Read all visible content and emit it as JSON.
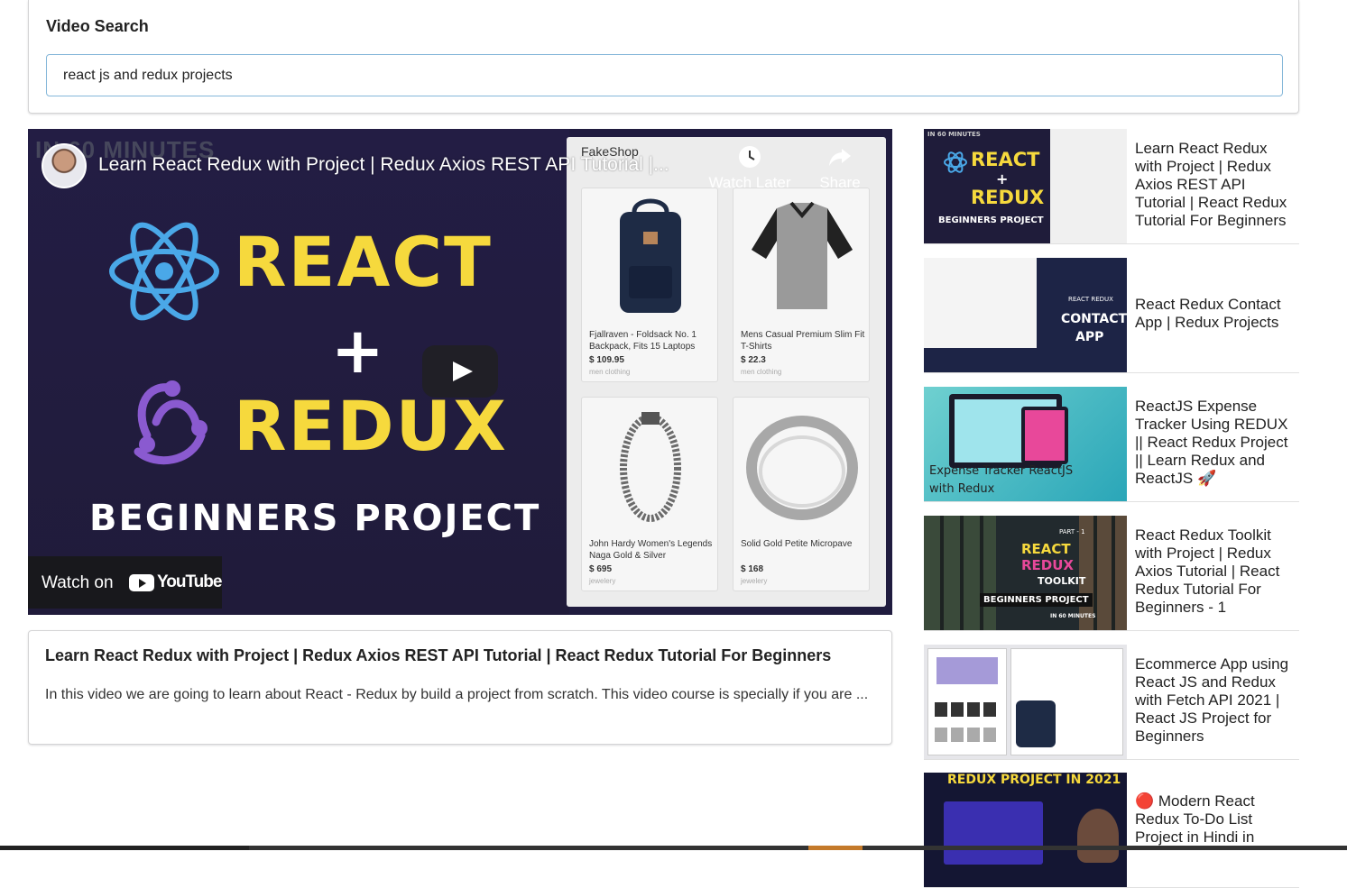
{
  "search": {
    "label": "Video Search",
    "value": "react js and redux projects"
  },
  "player": {
    "title": "Learn React Redux with Project | Redux Axios REST API Tutorial |...",
    "banner": "IN 60 MINUTES",
    "thumb_line1": "REACT",
    "thumb_plus": "+",
    "thumb_line2": "REDUX",
    "thumb_line3": "BEGINNERS PROJECT",
    "shop_name": "FakeShop",
    "products": [
      {
        "name": "Fjallraven - Foldsack No. 1 Backpack, Fits 15 Laptops",
        "price": "$ 109.95",
        "category": "men clothing"
      },
      {
        "name": "Mens Casual Premium Slim Fit T-Shirts",
        "price": "$ 22.3",
        "category": "men clothing"
      },
      {
        "name": "John Hardy Women's Legends Naga Gold & Silver",
        "price": "$ 695",
        "category": "jewelery"
      },
      {
        "name": "Solid Gold Petite Micropave",
        "price": "$ 168",
        "category": "jewelery"
      }
    ],
    "watch_later": "Watch Later",
    "share": "Share",
    "watch_on": "Watch on",
    "youtube": "YouTube"
  },
  "details": {
    "title": "Learn React Redux with Project | Redux Axios REST API Tutorial | React Redux Tutorial For Beginners",
    "description": "In this video we are going to learn about React - Redux by build a project from scratch. This video course is specially if you are ..."
  },
  "video_list": [
    {
      "title": "Learn React Redux with Project | Redux Axios REST API Tutorial | React Redux Tutorial For Beginners",
      "thumb_text": [
        "REACT",
        "+",
        "REDUX",
        "BEGINNERS PROJECT",
        "IN 60 MINUTES"
      ]
    },
    {
      "title": "React Redux Contact App | Redux Projects",
      "thumb_text": [
        "REACT REDUX",
        "CONTACT",
        "APP"
      ]
    },
    {
      "title": "ReactJS Expense Tracker Using REDUX || React Redux Project || Learn Redux and ReactJS 🚀",
      "thumb_text": [
        "Expense Tracker ReactJS",
        "with Redux"
      ]
    },
    {
      "title": "React Redux Toolkit with Project | Redux Axios Tutorial | React Redux Tutorial For Beginners - 1",
      "thumb_text": [
        "PART - 1",
        "REACT",
        "REDUX",
        "TOOLKIT",
        "BEGINNERS PROJECT",
        "IN 60 MINUTES"
      ]
    },
    {
      "title": "Ecommerce App using React JS and Redux with Fetch API 2021 | React JS Project for Beginners",
      "thumb_text": []
    },
    {
      "title": "🔴 Modern React Redux To-Do List Project in Hindi in",
      "thumb_text": [
        "REDUX PROJECT IN 2021"
      ]
    }
  ],
  "colors": {
    "accent_border": "#85b7d9",
    "thumb_yellow": "#f6d93d",
    "player_bg": "#201c3f"
  }
}
